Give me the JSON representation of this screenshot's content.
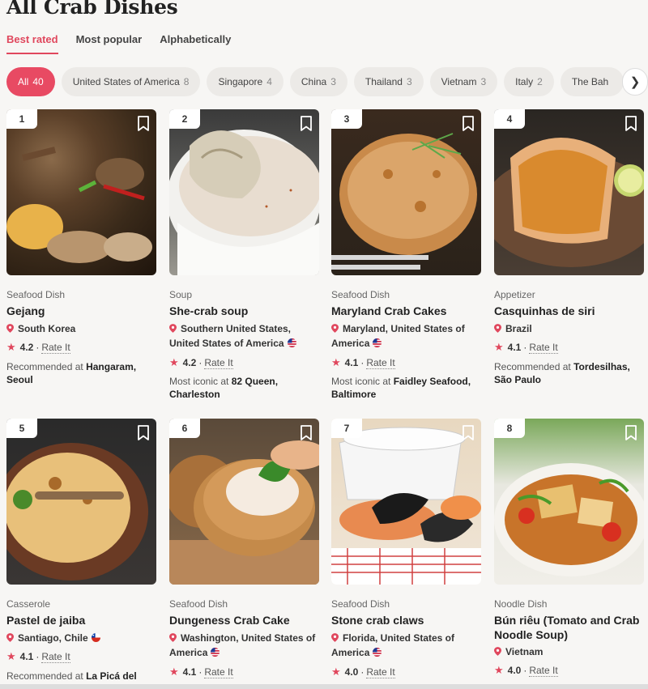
{
  "page": {
    "title": "All Crab Dishes"
  },
  "sort_tabs": [
    "Best rated",
    "Most popular",
    "Alphabetically"
  ],
  "filters": [
    {
      "label": "All",
      "count": "40"
    },
    {
      "label": "United States of America",
      "count": "8"
    },
    {
      "label": "Singapore",
      "count": "4"
    },
    {
      "label": "China",
      "count": "3"
    },
    {
      "label": "Thailand",
      "count": "3"
    },
    {
      "label": "Vietnam",
      "count": "3"
    },
    {
      "label": "Italy",
      "count": "2"
    },
    {
      "label": "The Bah",
      "count": ""
    }
  ],
  "dishes": [
    {
      "rank": "1",
      "category": "Seafood Dish",
      "name": "Gejang",
      "location": "South Korea",
      "flag": "",
      "rating": "4.2",
      "rate_label": "Rate It",
      "rec_prefix": "Recommended at",
      "rec_place": "Hangaram, Seoul"
    },
    {
      "rank": "2",
      "category": "Soup",
      "name": "She-crab soup",
      "location": "Southern United States, United States of America",
      "flag": "us-flag-icon",
      "rating": "4.2",
      "rate_label": "Rate It",
      "rec_prefix": "Most iconic at",
      "rec_place": "82 Queen, Charleston"
    },
    {
      "rank": "3",
      "category": "Seafood Dish",
      "name": "Maryland Crab Cakes",
      "location": "Maryland, United States of America",
      "flag": "us-flag-icon",
      "rating": "4.1",
      "rate_label": "Rate It",
      "rec_prefix": "Most iconic at",
      "rec_place": "Faidley Seafood, Baltimore"
    },
    {
      "rank": "4",
      "category": "Appetizer",
      "name": "Casquinhas de siri",
      "location": "Brazil",
      "flag": "",
      "rating": "4.1",
      "rate_label": "Rate It",
      "rec_prefix": "Recommended at",
      "rec_place": "Tordesilhas, São Paulo"
    },
    {
      "rank": "5",
      "category": "Casserole",
      "name": "Pastel de jaiba",
      "location": "Santiago, Chile",
      "flag": "chile-flag-icon",
      "rating": "4.1",
      "rate_label": "Rate It",
      "rec_prefix": "Recommended at",
      "rec_place": "La Picá del"
    },
    {
      "rank": "6",
      "category": "Seafood Dish",
      "name": "Dungeness Crab Cake",
      "location": "Washington, United States of America",
      "flag": "us-flag-icon",
      "rating": "4.1",
      "rate_label": "Rate It",
      "rec_prefix": "",
      "rec_place": ""
    },
    {
      "rank": "7",
      "category": "Seafood Dish",
      "name": "Stone crab claws",
      "location": "Florida, United States of America",
      "flag": "us-flag-icon",
      "rating": "4.0",
      "rate_label": "Rate It",
      "rec_prefix": "",
      "rec_place": ""
    },
    {
      "rank": "8",
      "category": "Noodle Dish",
      "name": "Bún riêu (Tomato and Crab Noodle Soup)",
      "location": "Vietnam",
      "flag": "",
      "rating": "4.0",
      "rate_label": "Rate It",
      "rec_prefix": "",
      "rec_place": ""
    }
  ],
  "colors": {
    "accent": "#e84a63",
    "pin": "#e0475d"
  }
}
